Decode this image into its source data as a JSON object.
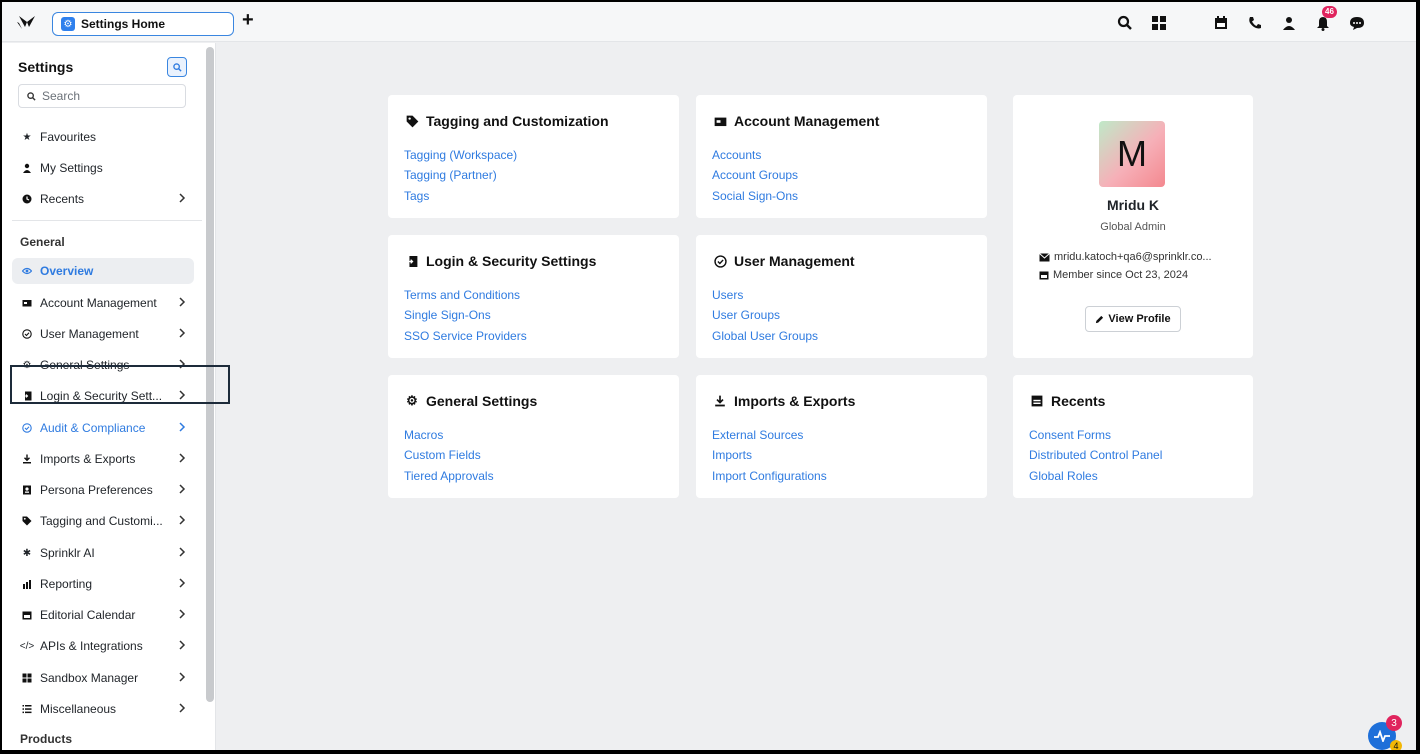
{
  "topbar": {
    "tab_label": "Settings Home",
    "notification_count": "46"
  },
  "sidebar": {
    "title": "Settings",
    "search_placeholder": "Search",
    "quick": [
      {
        "label": "Favourites",
        "icon": "star-icon"
      },
      {
        "label": "My Settings",
        "icon": "person-icon"
      },
      {
        "label": "Recents",
        "icon": "clock-icon"
      }
    ],
    "general_heading": "General",
    "items": [
      {
        "label": "Overview",
        "icon": "eye-icon"
      },
      {
        "label": "Account Management",
        "icon": "account-icon"
      },
      {
        "label": "User Management",
        "icon": "check-circle-icon"
      },
      {
        "label": "General Settings",
        "icon": "gear-icon"
      },
      {
        "label": "Login & Security Sett...",
        "icon": "login-icon"
      },
      {
        "label": "Audit & Compliance",
        "icon": "check-circle-icon"
      },
      {
        "label": "Imports & Exports",
        "icon": "download-icon"
      },
      {
        "label": "Persona Preferences",
        "icon": "persona-icon"
      },
      {
        "label": "Tagging and Customi...",
        "icon": "tag-icon"
      },
      {
        "label": "Sprinklr AI",
        "icon": "sparkle-icon"
      },
      {
        "label": "Reporting",
        "icon": "chart-icon"
      },
      {
        "label": "Editorial Calendar",
        "icon": "calendar-icon"
      },
      {
        "label": "APIs & Integrations",
        "icon": "code-icon"
      },
      {
        "label": "Sandbox Manager",
        "icon": "grid-icon"
      },
      {
        "label": "Miscellaneous",
        "icon": "list-icon"
      }
    ],
    "products_heading": "Products"
  },
  "cards": {
    "tagging": {
      "title": "Tagging and Customization",
      "links": [
        "Tagging (Workspace)",
        "Tagging (Partner)",
        "Tags"
      ]
    },
    "account": {
      "title": "Account Management",
      "links": [
        "Accounts",
        "Account Groups",
        "Social Sign-Ons"
      ]
    },
    "login": {
      "title": "Login & Security Settings",
      "links": [
        "Terms and Conditions",
        "Single Sign-Ons",
        "SSO Service Providers"
      ]
    },
    "user": {
      "title": "User Management",
      "links": [
        "Users",
        "User Groups",
        "Global User Groups"
      ]
    },
    "general": {
      "title": "General Settings",
      "links": [
        "Macros",
        "Custom Fields",
        "Tiered Approvals"
      ]
    },
    "imports": {
      "title": "Imports & Exports",
      "links": [
        "External Sources",
        "Imports",
        "Import Configurations"
      ]
    },
    "recents": {
      "title": "Recents",
      "links": [
        "Consent Forms",
        "Distributed Control Panel",
        "Global Roles"
      ]
    }
  },
  "profile": {
    "initial": "M",
    "name": "Mridu K",
    "role": "Global Admin",
    "email": "mridu.katoch+qa6@sprinklr.co...",
    "member_since": "Member since Oct 23, 2024",
    "view_profile": "View Profile"
  },
  "fab": {
    "badge_top": "3",
    "badge_bottom": "4"
  },
  "colors": {
    "accent": "#2f7be0",
    "badge": "#e0245e"
  }
}
